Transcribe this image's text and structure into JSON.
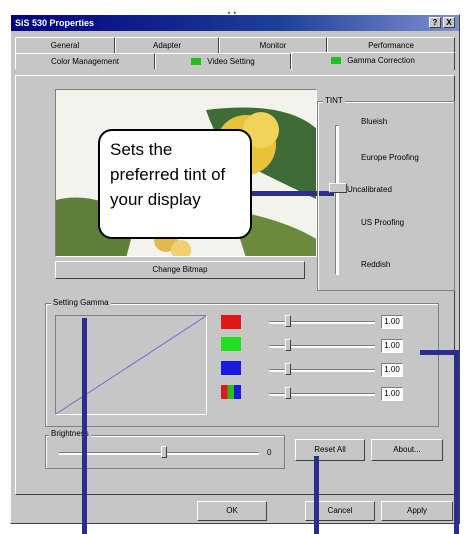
{
  "dialog": {
    "title": "SiS 530 Properties",
    "title_buttons": [
      "?",
      "X"
    ]
  },
  "tabs_row1": [
    "General",
    "Adapter",
    "Monitor",
    "Performance"
  ],
  "tabs_row2": [
    "Color Management",
    "Video Setting",
    "Gamma Correction"
  ],
  "tint": {
    "group_label": "TINT",
    "levels": [
      "Blueish",
      "Europe Proofing",
      "Uncalibrated",
      "US Proofing",
      "Reddish"
    ],
    "selected": "Uncalibrated"
  },
  "change_bitmap_label": "Change Bitmap",
  "setting_gamma": {
    "group_label": "Setting Gamma",
    "channels": [
      {
        "swatch": "red",
        "value": "1.00"
      },
      {
        "swatch": "green",
        "value": "1.00"
      },
      {
        "swatch": "blue",
        "value": "1.00"
      },
      {
        "swatch": "rgb",
        "value": "1.00"
      }
    ]
  },
  "brightness": {
    "label": "Brightness",
    "value": "0"
  },
  "reset_all_label": "Reset All",
  "about_label": "About...",
  "footer_buttons": [
    "OK",
    "Cancel",
    "Apply"
  ],
  "callout": {
    "lines": [
      "Sets the",
      "preferred tint of",
      "your display"
    ]
  },
  "colors": {
    "pointer": "#2b2e8c",
    "title_bar": "#000080",
    "gamma_curve": "#7070d0"
  },
  "icons": [
    "help-icon",
    "close-icon",
    "video-setting-icon",
    "gamma-correction-icon"
  ]
}
